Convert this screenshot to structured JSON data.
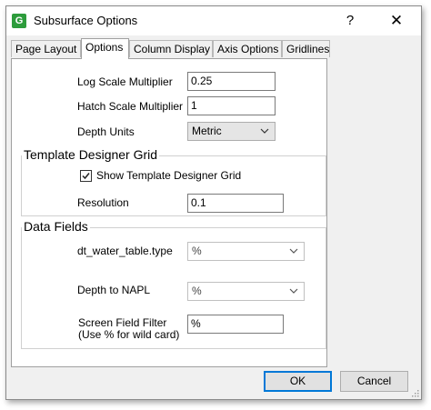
{
  "window": {
    "title": "Subsurface Options",
    "help": "?",
    "close": "✕",
    "app_icon": "G"
  },
  "tabs": [
    {
      "label": "Page Layout",
      "active": false
    },
    {
      "label": "Options",
      "active": true
    },
    {
      "label": "Column Display",
      "active": false
    },
    {
      "label": "Axis Options",
      "active": false
    },
    {
      "label": "Gridlines",
      "active": false
    }
  ],
  "options": {
    "log_scale_label": "Log Scale Multiplier",
    "log_scale_value": "0.25",
    "hatch_scale_label": "Hatch Scale Multiplier",
    "hatch_scale_value": "1",
    "depth_units_label": "Depth Units",
    "depth_units_value": "Metric"
  },
  "template_grid": {
    "title": "Template Designer Grid",
    "show_label": "Show Template Designer Grid",
    "show_checked": true,
    "resolution_label": "Resolution",
    "resolution_value": "0.1"
  },
  "data_fields": {
    "title": "Data Fields",
    "water_table_label": "dt_water_table.type",
    "water_table_value": "%",
    "napl_label": "Depth to NAPL",
    "napl_value": "%",
    "screen_filter_label_1": "Screen Field Filter",
    "screen_filter_label_2": "(Use % for wild card)",
    "screen_filter_value": "%"
  },
  "buttons": {
    "ok": "OK",
    "cancel": "Cancel"
  }
}
